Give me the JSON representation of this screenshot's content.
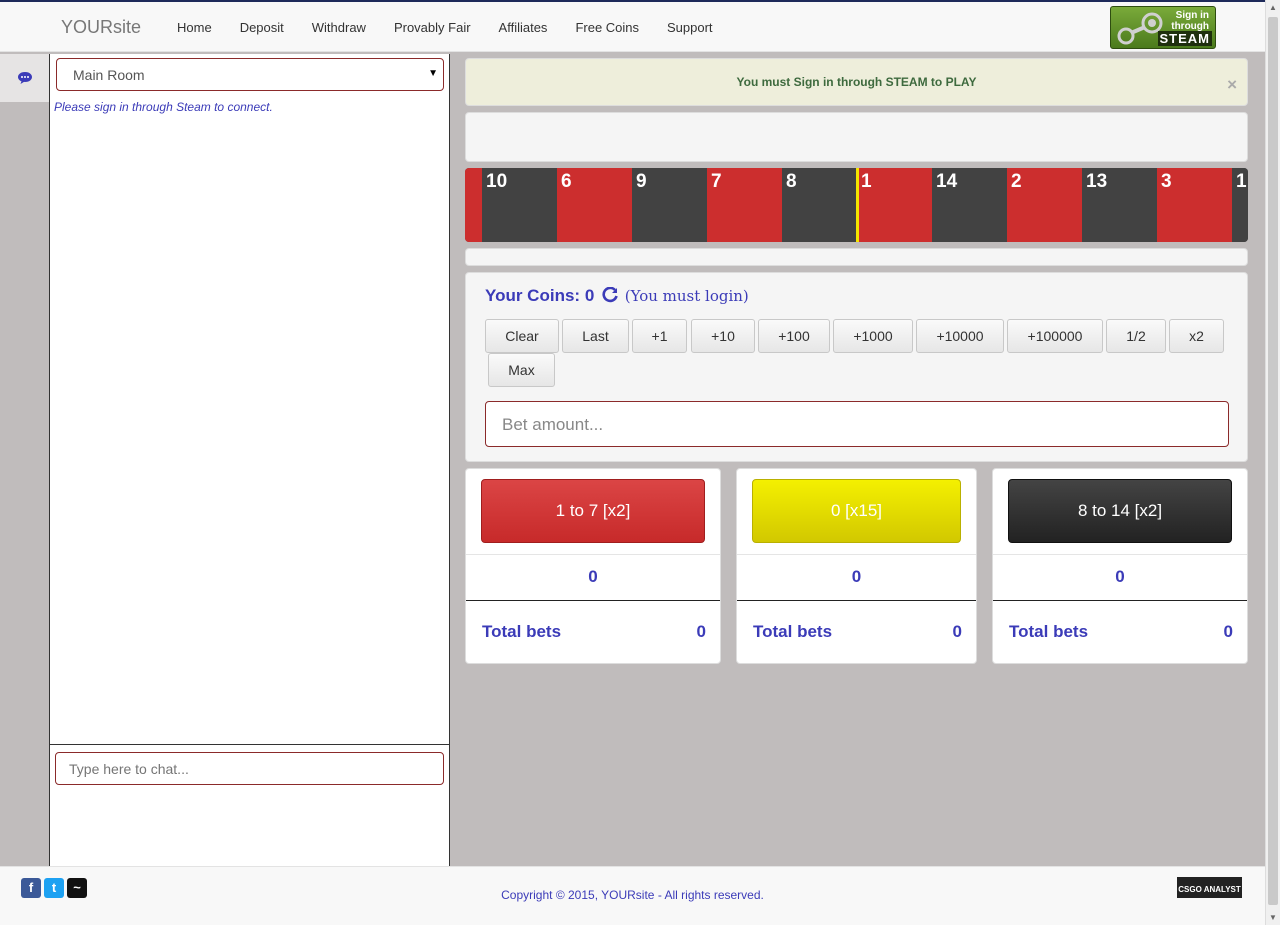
{
  "brand": "YOURsite",
  "nav": [
    "Home",
    "Deposit",
    "Withdraw",
    "Provably Fair",
    "Affiliates",
    "Free Coins",
    "Support"
  ],
  "steam_button": {
    "line1": "Sign in",
    "line2": "through",
    "line3": "STEAM"
  },
  "chat": {
    "room": "Main Room",
    "status_message": "Please sign in through Steam to connect.",
    "input_placeholder": "Type here to chat..."
  },
  "alert": {
    "message": "You must Sign in through STEAM to PLAY",
    "close": "×"
  },
  "wheel": {
    "cells": [
      {
        "n": "",
        "color": "red"
      },
      {
        "n": "10",
        "color": "black"
      },
      {
        "n": "6",
        "color": "red"
      },
      {
        "n": "9",
        "color": "black"
      },
      {
        "n": "7",
        "color": "red"
      },
      {
        "n": "8",
        "color": "black"
      },
      {
        "n": "1",
        "color": "red"
      },
      {
        "n": "14",
        "color": "black"
      },
      {
        "n": "2",
        "color": "red"
      },
      {
        "n": "13",
        "color": "black"
      },
      {
        "n": "3",
        "color": "red"
      },
      {
        "n": "1",
        "color": "black"
      }
    ]
  },
  "betting": {
    "coins_label": "Your Coins:",
    "coins_value": "0",
    "login_note": "(You must login)",
    "buttons": [
      "Clear",
      "Last",
      "+1",
      "+10",
      "+100",
      "+1000",
      "+10000",
      "+100000",
      "1/2",
      "x2",
      "Max"
    ],
    "amount_placeholder": "Bet amount..."
  },
  "choices": [
    {
      "label": "1 to 7 [x2]",
      "amount": "0",
      "total_label": "Total bets",
      "total": "0"
    },
    {
      "label": "0 [x15]",
      "amount": "0",
      "total_label": "Total bets",
      "total": "0"
    },
    {
      "label": "8 to 14 [x2]",
      "amount": "0",
      "total_label": "Total bets",
      "total": "0"
    }
  ],
  "footer": {
    "copyright": "Copyright © 2015, YOURsite - All rights reserved.",
    "social": [
      "f",
      "t",
      "~"
    ],
    "badge": "CSGO ANALYST"
  },
  "colors": {
    "accent": "#3b3bb8",
    "red": "#cc2e2e",
    "black": "#424242",
    "yellow": "#f4f000"
  }
}
